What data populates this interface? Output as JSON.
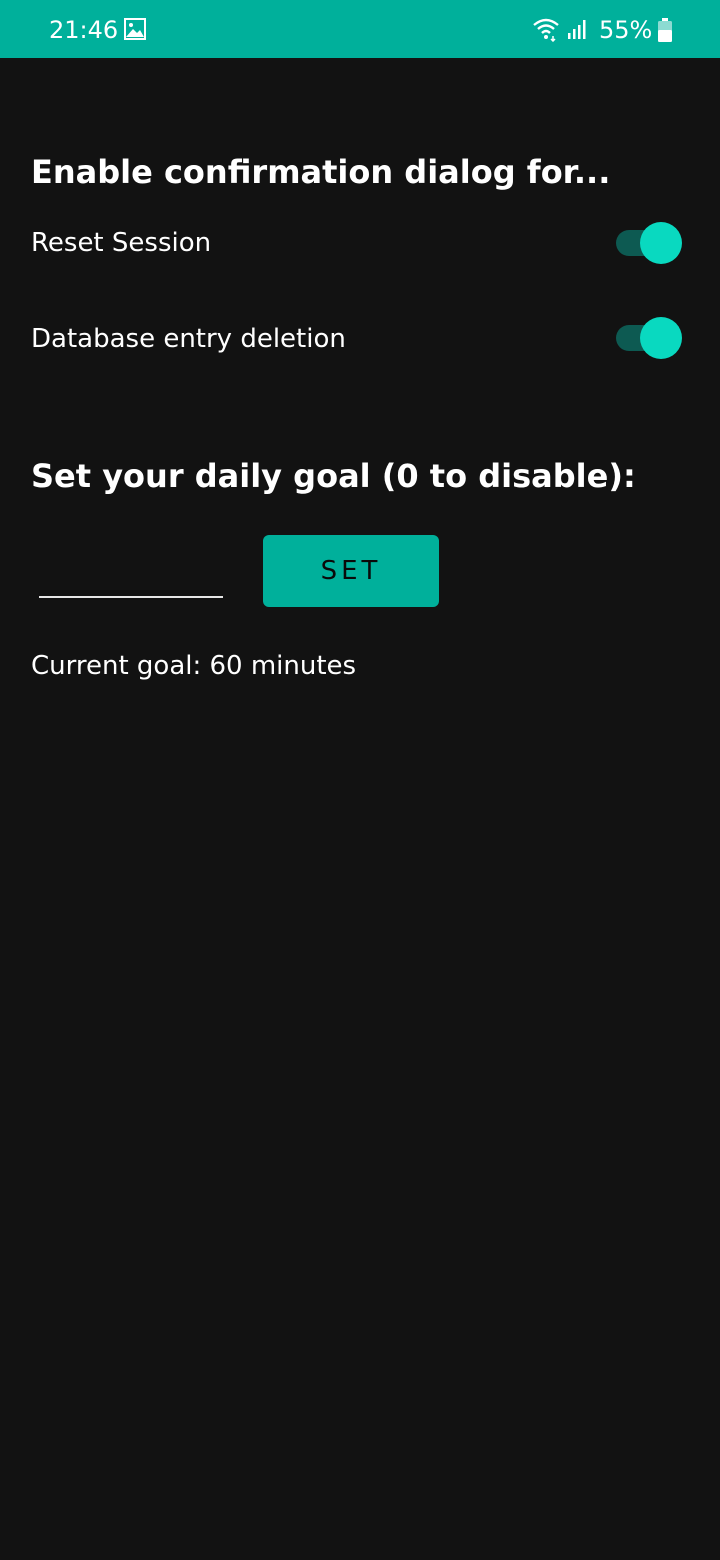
{
  "status_bar": {
    "time": "21:46",
    "battery_percent": "55%",
    "icons": [
      "image-icon",
      "wifi-icon",
      "signal-icon",
      "battery-icon"
    ]
  },
  "confirmation": {
    "title": "Enable confirmation dialog for...",
    "items": [
      {
        "label": "Reset Session",
        "enabled": true
      },
      {
        "label": "Database entry deletion",
        "enabled": true
      }
    ]
  },
  "goal": {
    "title": "Set your daily goal (0 to disable):",
    "input_value": "",
    "set_label": "SET",
    "current_text": "Current goal: 60 minutes"
  },
  "colors": {
    "accent": "#00b09b",
    "switch_thumb": "#09d9c0",
    "switch_track": "#0d5a52",
    "background": "#121212"
  }
}
